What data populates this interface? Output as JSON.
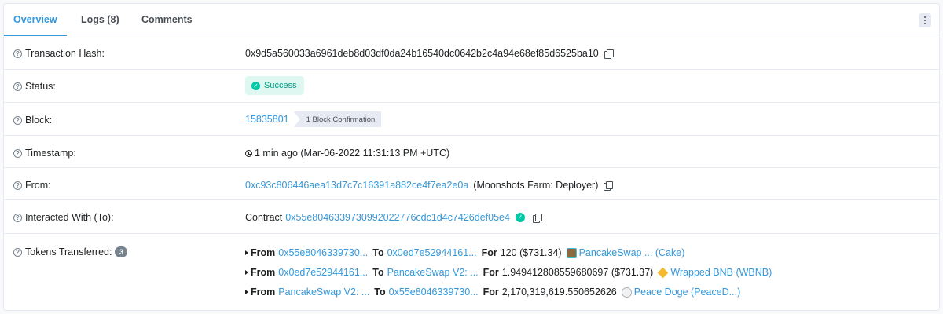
{
  "tabs": [
    {
      "label": "Overview",
      "active": true
    },
    {
      "label": "Logs (8)",
      "active": false
    },
    {
      "label": "Comments",
      "active": false
    }
  ],
  "rows": {
    "tx_hash": {
      "label": "Transaction Hash:",
      "value": "0x9d5a560033a6961deb8d03df0da24b16540dc0642b2c4a94e68ef85d6525ba10"
    },
    "status": {
      "label": "Status:",
      "value": "Success"
    },
    "block": {
      "label": "Block:",
      "value": "15835801",
      "confirmation": "1 Block Confirmation"
    },
    "timestamp": {
      "label": "Timestamp:",
      "value": "1 min ago (Mar-06-2022 11:31:13 PM +UTC)"
    },
    "from": {
      "label": "From:",
      "address": "0xc93c806446aea13d7c7c16391a882ce4f7ea2e0a",
      "name": "(Moonshots Farm: Deployer)"
    },
    "interacted": {
      "label": "Interacted With (To):",
      "prefix": "Contract",
      "address": "0x55e8046339730992022776cdc1d4c7426def05e4"
    },
    "tokens": {
      "label": "Tokens Transferred:",
      "count": "3"
    }
  },
  "transfers": [
    {
      "from_kw": "From",
      "from": "0x55e8046339730...",
      "to_kw": "To",
      "to": "0x0ed7e52944161...",
      "for_kw": "For",
      "amount": "120 ($731.34)",
      "token": "PancakeSwap ... (Cake)",
      "icon": "pancakeswap-token-icon"
    },
    {
      "from_kw": "From",
      "from": "0x0ed7e52944161...",
      "to_kw": "To",
      "to": "PancakeSwap V2: ...",
      "for_kw": "For",
      "amount": "1.949412808559680697 ($731.37)",
      "token": "Wrapped BNB (WBNB)",
      "icon": "bnb-token-icon"
    },
    {
      "from_kw": "From",
      "from": "PancakeSwap V2: ...",
      "to_kw": "To",
      "to": "0x55e8046339730...",
      "for_kw": "For",
      "amount": "2,170,319,619.550652626",
      "token": "Peace Doge (PeaceD...)",
      "icon": "peace-doge-token-icon"
    }
  ],
  "icons": {
    "help": "?",
    "check": "✓",
    "more": "more-vertical-icon"
  },
  "colors": {
    "link": "#3498db",
    "success": "#00c9a7",
    "success_bg": "#def7f0",
    "border": "#e7eaf3"
  }
}
